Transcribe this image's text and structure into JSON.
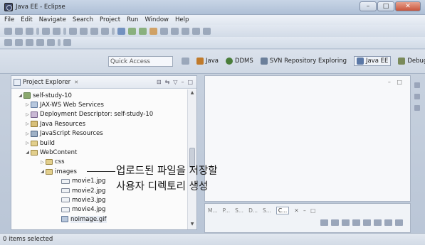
{
  "window": {
    "title": "Java EE - Eclipse",
    "minimize": "–",
    "maximize": "□",
    "close": "✕"
  },
  "menu": [
    "File",
    "Edit",
    "Navigate",
    "Search",
    "Project",
    "Run",
    "Window",
    "Help"
  ],
  "quick_access": {
    "placeholder": "Quick Access"
  },
  "perspectives": [
    {
      "label": "Java",
      "color": "#c07a2a"
    },
    {
      "label": "DDMS",
      "color": "#4a7d3a"
    },
    {
      "label": "SVN Repository Exploring",
      "color": "#6b7f9a"
    },
    {
      "label": "Java EE",
      "color": "#5b78a6",
      "active": true
    },
    {
      "label": "Debug",
      "color": "#7a8a5a"
    }
  ],
  "explorer": {
    "title": "Project Explorer",
    "tree": [
      {
        "label": "self-study-10",
        "icon": "project-icon",
        "arrow": "◢",
        "indent": 0
      },
      {
        "label": "JAX-WS Web Services",
        "icon": "web-services-icon",
        "arrow": "▷",
        "indent": 1
      },
      {
        "label": "Deployment Descriptor: self-study-10",
        "icon": "deployment-descriptor-icon",
        "arrow": "▷",
        "indent": 1
      },
      {
        "label": "Java Resources",
        "icon": "java-resources-icon",
        "arrow": "▷",
        "indent": 1
      },
      {
        "label": "JavaScript Resources",
        "icon": "javascript-resources-icon",
        "arrow": "▷",
        "indent": 1
      },
      {
        "label": "build",
        "icon": "folder-icon",
        "arrow": "▷",
        "indent": 1
      },
      {
        "label": "WebContent",
        "icon": "folder-icon",
        "arrow": "◢",
        "indent": 1
      },
      {
        "label": "css",
        "icon": "folder-icon",
        "arrow": "▷",
        "indent": 2
      },
      {
        "label": "images",
        "icon": "folder-icon",
        "arrow": "◢",
        "indent": 2
      },
      {
        "label": "movie1.jpg",
        "icon": "image-file-icon",
        "arrow": "",
        "indent": 3
      },
      {
        "label": "movie2.jpg",
        "icon": "image-file-icon",
        "arrow": "",
        "indent": 3
      },
      {
        "label": "movie3.jpg",
        "icon": "image-file-icon",
        "arrow": "",
        "indent": 3
      },
      {
        "label": "movie4.jpg",
        "icon": "image-file-icon",
        "arrow": "",
        "indent": 3
      },
      {
        "label": "noimage.gif",
        "icon": "gif-file-icon",
        "arrow": "",
        "indent": 3,
        "selected": true
      }
    ]
  },
  "bottom_tabs": [
    "M...",
    "P...",
    "S...",
    "D...",
    "S...",
    "C..."
  ],
  "status": "0 items selected",
  "annotation": {
    "line1": "업로드된 파일을 저장할",
    "line2": "사용자 디렉토리 생성"
  }
}
